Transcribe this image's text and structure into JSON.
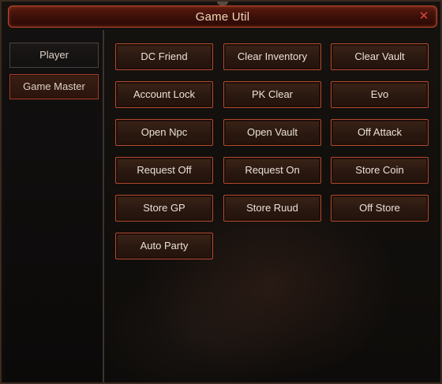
{
  "window": {
    "title": "Game Util",
    "close_glyph": "✕"
  },
  "sidebar": {
    "items": [
      {
        "label": "Player",
        "active": false
      },
      {
        "label": "Game Master",
        "active": true
      }
    ]
  },
  "actions": [
    "DC Friend",
    "Clear Inventory",
    "Clear Vault",
    "Account Lock",
    "PK Clear",
    "Evo",
    "Open Npc",
    "Open Vault",
    "Off Attack",
    "Request Off",
    "Request On",
    "Store Coin",
    "Store GP",
    "Store Ruud",
    "Off Store",
    "Auto Party"
  ],
  "colors": {
    "accent": "#b24a2e",
    "title_bar": "#4a140b",
    "text": "#eae2d6"
  }
}
